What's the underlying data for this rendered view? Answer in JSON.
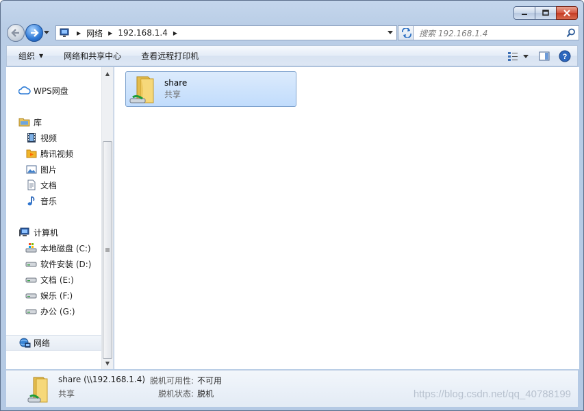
{
  "window": {
    "address": {
      "segments": [
        "网络",
        "192.168.1.4"
      ]
    },
    "search": {
      "placeholder": "搜索 192.168.1.4"
    }
  },
  "toolbar": {
    "organize": "组织",
    "network_center": "网络和共享中心",
    "remote_printers": "查看远程打印机"
  },
  "sidebar": {
    "wps": "WPS网盘",
    "libraries": "库",
    "library_items": [
      "视频",
      "腾讯视频",
      "图片",
      "文档",
      "音乐"
    ],
    "computer": "计算机",
    "drives": [
      "本地磁盘 (C:)",
      "软件安装 (D:)",
      "文档 (E:)",
      "娱乐 (F:)",
      "办公 (G:)"
    ],
    "network": "网络"
  },
  "content": {
    "items": [
      {
        "name": "share",
        "type": "共享"
      }
    ]
  },
  "details": {
    "title": "share (\\\\192.168.1.4)",
    "type": "共享",
    "offline_availability_label": "脱机可用性:",
    "offline_availability_value": "不可用",
    "offline_status_label": "脱机状态:",
    "offline_status_value": "脱机"
  },
  "watermark": "https://blog.csdn.net/qq_40788199",
  "colors": {
    "selection_bg": "#c9e0fb",
    "selection_border": "#7da2ce",
    "window_frame": "#b9cde6"
  }
}
